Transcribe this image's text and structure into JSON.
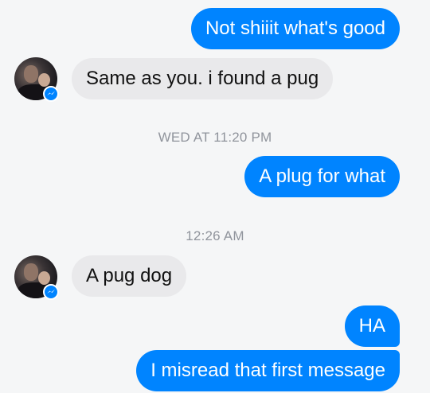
{
  "messages": [
    {
      "text": "Not shiiit what's good"
    },
    {
      "text": "Same as you. i found a pug"
    },
    {
      "text": "A plug for what"
    },
    {
      "text": "A pug dog"
    },
    {
      "text": "HA"
    },
    {
      "text": "I misread that first message"
    }
  ],
  "timestamps": [
    "WED AT 11:20 PM",
    "12:26 AM"
  ],
  "colors": {
    "outgoing_bubble": "#0084ff",
    "incoming_bubble": "#e9e9eb",
    "timestamp": "#90949c",
    "background": "#f5f6f7"
  },
  "icons": {
    "avatar_badge": "messenger-icon"
  }
}
